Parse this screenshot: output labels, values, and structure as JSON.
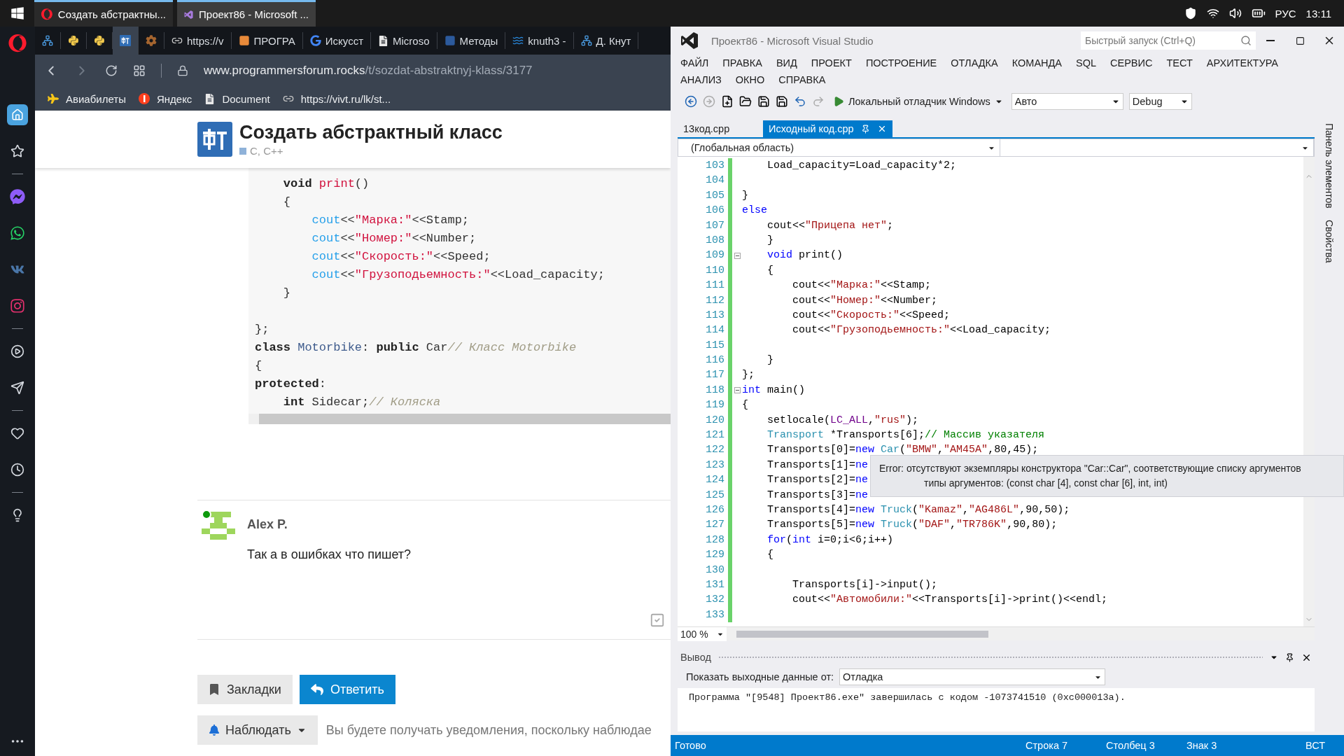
{
  "taskbar": {
    "tasks": [
      {
        "title": "Создать абстрактны...",
        "selected": false
      },
      {
        "title": "Проект86 - Microsoft ...",
        "selected": true
      }
    ],
    "language": "РУС",
    "time": "13:11"
  },
  "browser": {
    "sidebar": [
      {
        "kind": "home",
        "selected": true
      },
      {
        "kind": "star",
        "selected": false
      },
      {
        "kind": "divider"
      },
      {
        "kind": "messenger",
        "selected": false
      },
      {
        "kind": "whatsapp",
        "selected": false
      },
      {
        "kind": "vk",
        "selected": false
      },
      {
        "kind": "instagram",
        "selected": false
      },
      {
        "kind": "divider"
      },
      {
        "kind": "play",
        "selected": false
      },
      {
        "kind": "send",
        "selected": false
      },
      {
        "kind": "divider"
      },
      {
        "kind": "heart",
        "selected": false
      },
      {
        "kind": "clock",
        "selected": false
      },
      {
        "kind": "divider"
      },
      {
        "kind": "bulb",
        "selected": false
      }
    ],
    "tabs": [
      {
        "selected": false
      },
      {
        "selected": false
      },
      {
        "selected": false
      },
      {
        "selected": true
      },
      {
        "selected": false
      },
      {
        "title": "https://v",
        "selected": false
      },
      {
        "title": "ПРОГРА",
        "selected": false
      },
      {
        "title": "Искусст",
        "selected": false
      },
      {
        "title": "Microso",
        "selected": false
      },
      {
        "title": "Методы",
        "selected": false
      },
      {
        "title": "knuth3 -",
        "selected": false
      },
      {
        "title": "Д. Кнут",
        "selected": false
      }
    ],
    "url": {
      "host": "www.programmersforum.rocks",
      "path": "/t/sozdat-abstraktnyj-klass/3177"
    },
    "bookmarks": [
      "Авиабилеты",
      "Яндекс",
      "Document",
      "https://vivt.ru/lk/st..."
    ]
  },
  "page": {
    "title": "Создать абстрактный класс",
    "category": "C, C++",
    "code_paragraphs": [
      [
        {
          "tokens": [
            {
              "kind": "keyword",
              "text": "    void"
            },
            {
              "kind": "function",
              "text": " print"
            },
            {
              "kind": "plain",
              "text": "()"
            }
          ]
        },
        {
          "tokens": [
            {
              "kind": "plain",
              "text": "    {"
            }
          ]
        },
        {
          "tokens": [
            {
              "kind": "stream",
              "text": "        cout"
            },
            {
              "kind": "plain",
              "text": "<<"
            },
            {
              "kind": "string",
              "text": "\"Марка:\""
            },
            {
              "kind": "plain",
              "text": "<<Stamp;"
            }
          ]
        },
        {
          "tokens": [
            {
              "kind": "stream",
              "text": "        cout"
            },
            {
              "kind": "plain",
              "text": "<<"
            },
            {
              "kind": "string",
              "text": "\"Номер:\""
            },
            {
              "kind": "plain",
              "text": "<<Number;"
            }
          ]
        },
        {
          "tokens": [
            {
              "kind": "stream",
              "text": "        cout"
            },
            {
              "kind": "plain",
              "text": "<<"
            },
            {
              "kind": "string",
              "text": "\"Скорость:\""
            },
            {
              "kind": "plain",
              "text": "<<Speed;"
            }
          ]
        },
        {
          "tokens": [
            {
              "kind": "stream",
              "text": "        cout"
            },
            {
              "kind": "plain",
              "text": "<<"
            },
            {
              "kind": "string",
              "text": "\"Грузоподьемность:\""
            },
            {
              "kind": "plain",
              "text": "<<Load_capacity;"
            }
          ]
        },
        {
          "tokens": [
            {
              "kind": "plain",
              "text": "    }"
            }
          ]
        }
      ],
      [
        {
          "tokens": [
            {
              "kind": "plain",
              "text": "};"
            }
          ]
        },
        {
          "tokens": [
            {
              "kind": "keyword",
              "text": "class"
            },
            {
              "kind": "type",
              "text": " Motorbike"
            },
            {
              "kind": "plain",
              "text": ": "
            },
            {
              "kind": "keyword",
              "text": "public"
            },
            {
              "kind": "plain",
              "text": " Car"
            },
            {
              "kind": "comment",
              "text": "// Класс Motorbike"
            }
          ]
        },
        {
          "tokens": [
            {
              "kind": "plain",
              "text": "{"
            }
          ]
        },
        {
          "tokens": [
            {
              "kind": "keyword",
              "text": "protected"
            },
            {
              "kind": "plain",
              "text": ":"
            }
          ]
        },
        {
          "tokens": [
            {
              "kind": "keyword",
              "text": "    int"
            },
            {
              "kind": "plain",
              "text": " Sidecar;"
            },
            {
              "kind": "comment",
              "text": "// Коляска"
            }
          ]
        }
      ]
    ],
    "post": {
      "author": "Alex P.",
      "text": "Так а в ошибках что пишет?",
      "online": true
    },
    "buttons": [
      {
        "kind": "bookmark",
        "label": "Закладки"
      },
      {
        "kind": "reply",
        "label": "Ответить"
      }
    ],
    "watch_button": "Наблюдать",
    "watch_note": "Вы будете получать уведомления, поскольку наблюдае"
  },
  "vs": {
    "title": "Проект86 - Microsoft Visual Studio",
    "quick_launch": "Быстрый запуск (Ctrl+Q)",
    "menu_rows": [
      [
        "ФАЙЛ",
        "ПРАВКА",
        "ВИД",
        "ПРОЕКТ",
        "ПОСТРОЕНИЕ",
        "ОТЛАДКА",
        "КОМАНДА",
        "SQL",
        "СЕРВИС",
        "ТЕСТ",
        "АРХИТЕКТУРА"
      ],
      [
        "АНАЛИЗ",
        "ОКНО",
        "СПРАВКА"
      ]
    ],
    "debugger": "Локальный отладчик Windows",
    "platform": "Авто",
    "configuration": "Debug",
    "tabs": [
      {
        "label": "13код.cpp",
        "selected": false
      },
      {
        "label": "Исходный код.cpp",
        "selected": true
      }
    ],
    "scope": "(Глобальная область)",
    "code_lines": [
      {
        "number": "103",
        "tokens": [
          {
            "kind": "plain",
            "text": "    Load_capacity=Load_capacity*2;"
          }
        ]
      },
      {
        "number": "104"
      },
      {
        "number": "105",
        "tokens": [
          {
            "kind": "plain",
            "text": "}"
          }
        ]
      },
      {
        "number": "106",
        "tokens": [
          {
            "kind": "keyword",
            "text": "else"
          }
        ]
      },
      {
        "number": "107",
        "tokens": [
          {
            "kind": "plain",
            "text": "    cout<<"
          },
          {
            "kind": "string",
            "text": "\"Прицепа нет\""
          },
          {
            "kind": "plain",
            "text": ";"
          }
        ]
      },
      {
        "number": "108",
        "tokens": [
          {
            "kind": "plain",
            "text": "    }"
          }
        ]
      },
      {
        "number": "109",
        "fold": true,
        "tokens": [
          {
            "kind": "keyword",
            "text": "    void"
          },
          {
            "kind": "plain",
            "text": " print()"
          }
        ]
      },
      {
        "number": "110",
        "tokens": [
          {
            "kind": "plain",
            "text": "    {"
          }
        ]
      },
      {
        "number": "111",
        "tokens": [
          {
            "kind": "plain",
            "text": "        cout<<"
          },
          {
            "kind": "string",
            "text": "\"Марка:\""
          },
          {
            "kind": "plain",
            "text": "<<Stamp;"
          }
        ]
      },
      {
        "number": "112",
        "tokens": [
          {
            "kind": "plain",
            "text": "        cout<<"
          },
          {
            "kind": "string",
            "text": "\"Номер:\""
          },
          {
            "kind": "plain",
            "text": "<<Number;"
          }
        ]
      },
      {
        "number": "113",
        "tokens": [
          {
            "kind": "plain",
            "text": "        cout<<"
          },
          {
            "kind": "string",
            "text": "\"Скорость:\""
          },
          {
            "kind": "plain",
            "text": "<<Speed;"
          }
        ]
      },
      {
        "number": "114",
        "tokens": [
          {
            "kind": "plain",
            "text": "        cout<<"
          },
          {
            "kind": "string",
            "text": "\"Грузоподьемность:\""
          },
          {
            "kind": "plain",
            "text": "<<Load_capacity;"
          }
        ]
      },
      {
        "number": "115"
      },
      {
        "number": "116",
        "tokens": [
          {
            "kind": "plain",
            "text": "    }"
          }
        ]
      },
      {
        "number": "117",
        "tokens": [
          {
            "kind": "plain",
            "text": "};"
          }
        ]
      },
      {
        "number": "118",
        "fold": true,
        "tokens": [
          {
            "kind": "keyword",
            "text": "int"
          },
          {
            "kind": "plain",
            "text": " main()"
          }
        ]
      },
      {
        "number": "119",
        "tokens": [
          {
            "kind": "plain",
            "text": "{"
          }
        ]
      },
      {
        "number": "120",
        "tokens": [
          {
            "kind": "plain",
            "text": "    setlocale("
          },
          {
            "kind": "macro",
            "text": "LC_ALL"
          },
          {
            "kind": "plain",
            "text": ","
          },
          {
            "kind": "string",
            "text": "\"rus\""
          },
          {
            "kind": "plain",
            "text": ");"
          }
        ]
      },
      {
        "number": "121",
        "tokens": [
          {
            "kind": "type",
            "text": "    Transport"
          },
          {
            "kind": "plain",
            "text": " *Transports[6];"
          },
          {
            "kind": "comment",
            "text": "// Массив указателя"
          }
        ]
      },
      {
        "number": "122",
        "tokens": [
          {
            "kind": "plain",
            "text": "    Transports[0]="
          },
          {
            "kind": "keyword",
            "text": "new"
          },
          {
            "kind": "type",
            "text": " Car"
          },
          {
            "kind": "plain",
            "text": "("
          },
          {
            "kind": "string",
            "text": "\"BMW\""
          },
          {
            "kind": "plain",
            "text": ","
          },
          {
            "kind": "string",
            "text": "\"AM45A\""
          },
          {
            "kind": "plain",
            "text": ",80,45);"
          }
        ]
      },
      {
        "number": "123",
        "tokens": [
          {
            "kind": "plain",
            "text": "    Transports[1]="
          },
          {
            "kind": "keyword",
            "text": "ne"
          }
        ]
      },
      {
        "number": "124",
        "tokens": [
          {
            "kind": "plain",
            "text": "    Transports[2]="
          },
          {
            "kind": "keyword",
            "text": "ne"
          }
        ]
      },
      {
        "number": "125",
        "tokens": [
          {
            "kind": "plain",
            "text": "    Transports[3]="
          },
          {
            "kind": "keyword",
            "text": "ne"
          }
        ]
      },
      {
        "number": "126",
        "tokens": [
          {
            "kind": "plain",
            "text": "    Transports[4]="
          },
          {
            "kind": "keyword",
            "text": "new"
          },
          {
            "kind": "type",
            "text": " Truck"
          },
          {
            "kind": "plain",
            "text": "("
          },
          {
            "kind": "string",
            "text": "\"Kamaz\""
          },
          {
            "kind": "plain",
            "text": ","
          },
          {
            "kind": "string",
            "text": "\"AG486L\""
          },
          {
            "kind": "plain",
            "text": ",90,50);"
          }
        ]
      },
      {
        "number": "127",
        "tokens": [
          {
            "kind": "plain",
            "text": "    Transports[5]="
          },
          {
            "kind": "keyword",
            "text": "new"
          },
          {
            "kind": "type",
            "text": " Truck"
          },
          {
            "kind": "plain",
            "text": "("
          },
          {
            "kind": "string",
            "text": "\"DAF\""
          },
          {
            "kind": "plain",
            "text": ","
          },
          {
            "kind": "string",
            "text": "\"TR786K\""
          },
          {
            "kind": "plain",
            "text": ",90,80);"
          }
        ]
      },
      {
        "number": "128",
        "tokens": [
          {
            "kind": "keyword",
            "text": "    for"
          },
          {
            "kind": "plain",
            "text": "("
          },
          {
            "kind": "keyword",
            "text": "int"
          },
          {
            "kind": "plain",
            "text": " i=0;i<6;i++)"
          }
        ]
      },
      {
        "number": "129",
        "tokens": [
          {
            "kind": "plain",
            "text": "    {"
          }
        ]
      },
      {
        "number": "130"
      },
      {
        "number": "131",
        "tokens": [
          {
            "kind": "plain",
            "text": "        Transports[i]->input();"
          }
        ]
      },
      {
        "number": "132",
        "tokens": [
          {
            "kind": "plain",
            "text": "        cout<<"
          },
          {
            "kind": "string",
            "text": "\"Автомобили:\""
          },
          {
            "kind": "plain",
            "text": "<<Transports[i]->print()<<endl;"
          }
        ]
      },
      {
        "number": "133"
      }
    ],
    "error_tooltip": [
      "Error: отсутствуют экземпляры конструктора \"Car::Car\", соответствующие списку аргументов",
      "типы аргументов: (const char [4], const char [6], int, int)"
    ],
    "zoom": "100 %",
    "side_panels": [
      "Панель элементов",
      "Свойства"
    ],
    "output": {
      "title": "Вывод",
      "source_label": "Показать выходные данные от:",
      "source": "Отладка",
      "text": "Программа \"[9548] Проект86.exe\" завершилась с кодом -1073741510 (0xc000013a)."
    },
    "status": {
      "state": "Готово",
      "line": "Строка 7",
      "column": "Столбец 3",
      "char": "Знак 3",
      "mode": "ВСТ"
    }
  }
}
